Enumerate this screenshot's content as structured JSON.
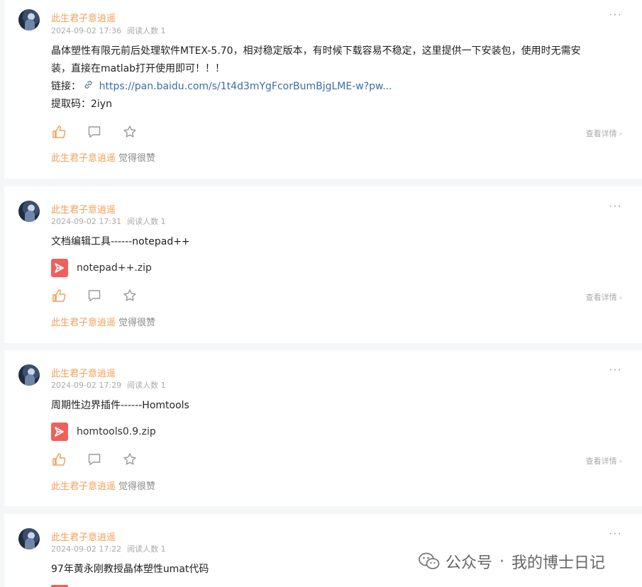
{
  "posts": [
    {
      "author": "此生君子意逍遥",
      "date": "2024-09-02 17:36",
      "reads": "阅读人数 1",
      "text1": "晶体塑性有限元前后处理软件MTEX-5.70，相对稳定版本，有时候下载容易不稳定，这里提供一下安装包，使用时无需安",
      "text2": "装，直接在matlab打开使用即可！！！",
      "link_label": "链接：",
      "link_text": "https://pan.baidu.com/s/1t4d3mYgFcorBumBjgLME-w?pw...",
      "code_label": "提取码：2iyn",
      "detail": "查看详情",
      "liker": "此生君子意逍遥",
      "like_text": "觉得很赞"
    },
    {
      "author": "此生君子意逍遥",
      "date": "2024-09-02 17:31",
      "reads": "阅读人数 1",
      "text1": "文档编辑工具------notepad++",
      "file": "notepad++.zip",
      "detail": "查看详情",
      "liker": "此生君子意逍遥",
      "like_text": "觉得很赞"
    },
    {
      "author": "此生君子意逍遥",
      "date": "2024-09-02 17:29",
      "reads": "阅读人数 1",
      "text1": "周期性边界插件------Homtools",
      "file": "homtools0.9.zip",
      "detail": "查看详情",
      "liker": "此生君子意逍遥",
      "like_text": "觉得很赞"
    },
    {
      "author": "此生君子意逍遥",
      "date": "2024-09-02 17:22",
      "reads": "阅读人数 1",
      "text1": "97年黄永刚教授晶体塑性umat代码"
    }
  ],
  "more_glyph": "···",
  "detail_arrow": "›",
  "watermark": {
    "label1": "公众号",
    "sep": "·",
    "label2": "我的博士日记"
  },
  "colors": {
    "accent": "#f0a05a",
    "link": "#3a6ea5",
    "file_icon": "#f0605a",
    "meta": "#aaaaaa"
  },
  "icons": [
    "thumbs-up-icon",
    "comment-icon",
    "star-icon",
    "link-icon",
    "file-icon",
    "more-icon",
    "chevron-right-icon",
    "wechat-icon"
  ]
}
